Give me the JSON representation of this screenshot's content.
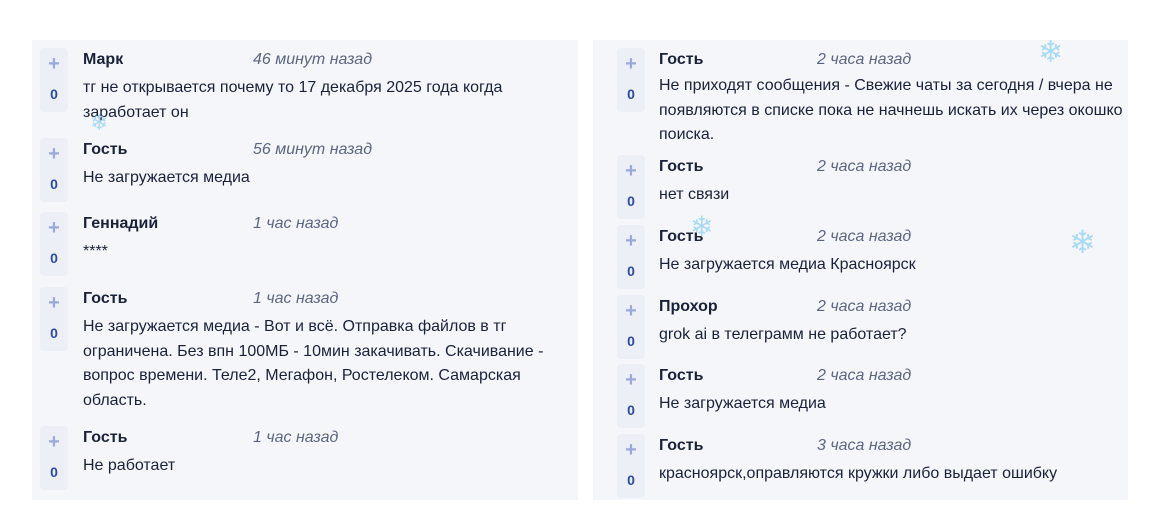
{
  "left_comments": [
    {
      "author": "Марк",
      "time": "46 минут назад",
      "text": "тг не открывается почему то 17 декабря 2025 года когда заработает он",
      "votes": "0"
    },
    {
      "author": "Гость",
      "time": "56 минут назад",
      "text": "Не загружается медиа",
      "votes": "0"
    },
    {
      "author": "Геннадий",
      "time": "1 час назад",
      "text": "****",
      "votes": "0"
    },
    {
      "author": "Гость",
      "time": "1 час назад",
      "text": "Не загружается медиа - Вот и всё. Отправка файлов в тг ограничена. Без впн 100МБ - 10мин закачивать. Скачивание - вопрос времени. Теле2, Мегафон, Ростелеком. Самарская область.",
      "votes": "0"
    },
    {
      "author": "Гость",
      "time": "1 час назад",
      "text": "Не работает",
      "votes": "0"
    }
  ],
  "right_comments": [
    {
      "author": "Гость",
      "time": "2 часа назад",
      "text": "Не приходят сообщения - Свежие чаты за сегодня / вчера не появляются в списке пока не начнешь искать их через окошко поиска.",
      "votes": "0"
    },
    {
      "author": "Гость",
      "time": "2 часа назад",
      "text": "нет связи",
      "votes": "0"
    },
    {
      "author": "Гость",
      "time": "2 часа назад",
      "text": "Не загружается медиа Красноярск",
      "votes": "0"
    },
    {
      "author": "Прохор",
      "time": "2 часа назад",
      "text": "grok ai в телеграмм не работает?",
      "votes": "0"
    },
    {
      "author": "Гость",
      "time": "2 часа назад",
      "text": "Не загружается медиа",
      "votes": "0"
    },
    {
      "author": "Гость",
      "time": "3 часа назад",
      "text": "красноярск,оправляются кружки либо выдает ошибку",
      "votes": "0"
    }
  ],
  "vote_symbol": "+",
  "snowflake_glyph": "❄",
  "colors": {
    "panel_bg": "#f5f6fa",
    "vote_bg": "#eceff6",
    "vote_plus": "#9aa9d8",
    "vote_count": "#2d4aa8",
    "author": "#1a2238",
    "time": "#5d6680",
    "snowflake": "#a8daf5"
  }
}
